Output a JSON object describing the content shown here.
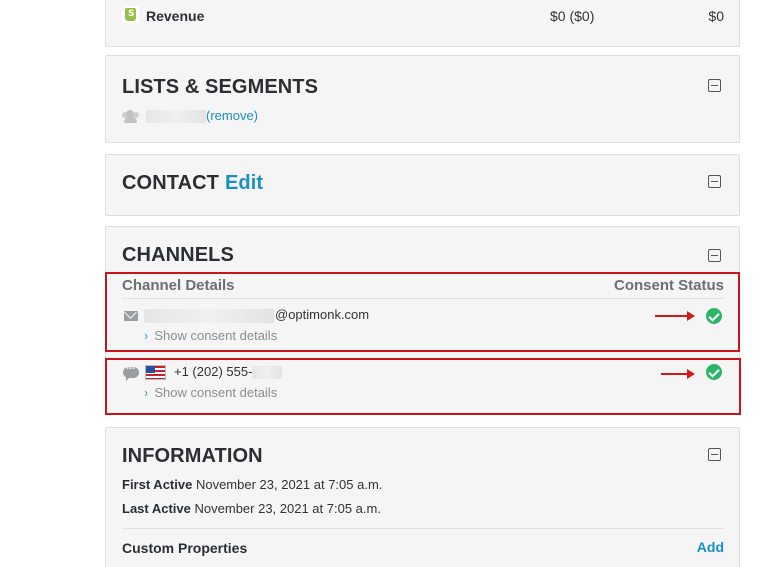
{
  "revenue": {
    "label": "Revenue",
    "mid_value": "$0 ($0)",
    "total": "$0"
  },
  "lists": {
    "title": "LISTS & SEGMENTS",
    "remove_label": "(remove)"
  },
  "contact": {
    "title": "CONTACT",
    "edit_label": "Edit"
  },
  "channels": {
    "title": "CHANNELS",
    "header_left": "Channel Details",
    "header_right": "Consent Status",
    "email": {
      "suffix": "@optimonk.com",
      "details_label": "Show consent details",
      "consent": "granted"
    },
    "sms": {
      "number": "+1 (202) 555-",
      "details_label": "Show consent details",
      "consent": "granted"
    }
  },
  "information": {
    "title": "INFORMATION",
    "first_active_label": "First Active",
    "first_active_value": "November 23, 2021 at 7:05 a.m.",
    "last_active_label": "Last Active",
    "last_active_value": "November 23, 2021 at 7:05 a.m.",
    "custom_properties_label": "Custom Properties",
    "add_label": "Add"
  },
  "colors": {
    "accent": "#1a8fc5",
    "consent_green": "#2cb56a",
    "annotation_red": "#c8151b"
  }
}
